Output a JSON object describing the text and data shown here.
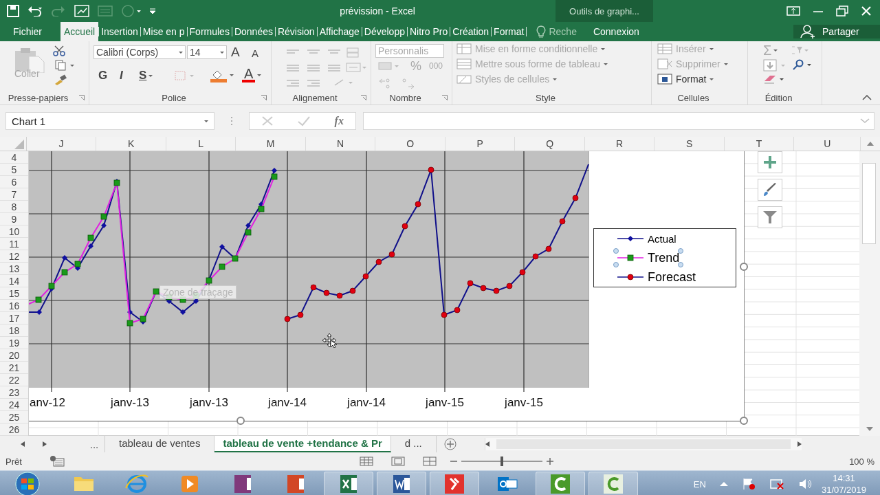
{
  "window": {
    "title": "prévission - Excel",
    "context_tab": "Outils de graphi..."
  },
  "ribbon_tabs": [
    {
      "label": "Fichier",
      "selected": false
    },
    {
      "label": "Accueil",
      "selected": true
    },
    {
      "label": "Insertion",
      "selected": false
    },
    {
      "label": "Mise en p",
      "selected": false
    },
    {
      "label": "Formules",
      "selected": false
    },
    {
      "label": "Données",
      "selected": false
    },
    {
      "label": "Révision",
      "selected": false
    },
    {
      "label": "Affichage",
      "selected": false
    },
    {
      "label": "Développ",
      "selected": false
    },
    {
      "label": "Nitro Pro",
      "selected": false
    },
    {
      "label": "Création",
      "selected": false
    },
    {
      "label": "Format",
      "selected": false
    }
  ],
  "search": {
    "placeholder": "Reche"
  },
  "sign_in": "Connexion",
  "share": "Partager",
  "ribbon": {
    "clipboard": {
      "paste": "Coller",
      "label": "Presse-papiers"
    },
    "font": {
      "name": "Calibri (Corps)",
      "size": "14",
      "grow": "A",
      "shrink": "A",
      "bold": "G",
      "italic": "I",
      "underline": "S",
      "color_letter": "A",
      "label": "Police"
    },
    "alignment": {
      "label": "Alignement"
    },
    "number": {
      "format": "Personnalis",
      "percent": "%",
      "thousands": "000",
      "label": "Nombre"
    },
    "styles": {
      "items": [
        {
          "label": "Mise en forme conditionnelle",
          "disabled": true
        },
        {
          "label": "Mettre sous forme de tableau",
          "disabled": true
        },
        {
          "label": "Styles de cellules",
          "disabled": true
        }
      ],
      "label": "Style"
    },
    "cells": {
      "items": [
        {
          "label": "Insérer",
          "disabled": true
        },
        {
          "label": "Supprimer",
          "disabled": true
        },
        {
          "label": "Format",
          "disabled": false
        }
      ],
      "label": "Cellules"
    },
    "editing": {
      "sum": "Σ",
      "label": "Édition"
    }
  },
  "formula_bar": {
    "name_box": "Chart 1",
    "fx": "fx"
  },
  "columns": [
    "J",
    "K",
    "L",
    "M",
    "N",
    "O",
    "P",
    "Q",
    "R",
    "S",
    "T",
    "U"
  ],
  "rows": [
    "4",
    "5",
    "6",
    "7",
    "8",
    "9",
    "10",
    "11",
    "12",
    "13",
    "14",
    "15",
    "16",
    "17",
    "18",
    "19",
    "20",
    "21",
    "22",
    "23",
    "24",
    "25",
    "26"
  ],
  "chart": {
    "x_labels": [
      "anv-12",
      "janv-13",
      "janv-13",
      "janv-14",
      "janv-14",
      "janv-15",
      "janv-15"
    ],
    "legend": [
      {
        "label": "Actual",
        "kind": "diamond",
        "selected": false
      },
      {
        "label": "Trend",
        "kind": "square",
        "selected": true
      },
      {
        "label": "Forecast",
        "kind": "circle",
        "selected": false
      }
    ],
    "tooltip": "Zone de traçage"
  },
  "sheet_nav": {
    "more": "..."
  },
  "sheets": [
    {
      "label": "tableau de ventes",
      "selected": false
    },
    {
      "label": "tableau de vente +tendance & Pr",
      "selected": true
    },
    {
      "label": "d ...",
      "selected": false
    }
  ],
  "status": {
    "text": "Prêt",
    "zoom": "100 %",
    "zoom_slider": {
      "level": 0.5
    }
  },
  "taskbar": {
    "language": "EN",
    "time": "14:31",
    "date": "31/07/2019"
  }
}
